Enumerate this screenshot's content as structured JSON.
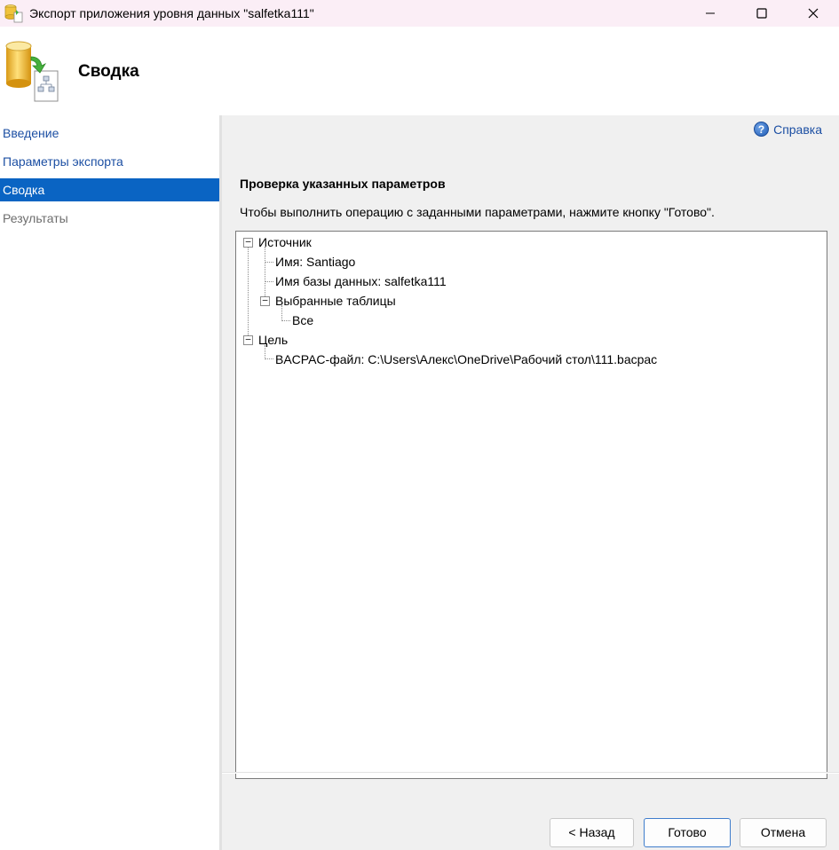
{
  "window": {
    "title": "Экспорт приложения уровня данных \"salfetka111\""
  },
  "header": {
    "title": "Сводка"
  },
  "sidebar": {
    "items": [
      {
        "label": "Введение",
        "state": "link"
      },
      {
        "label": "Параметры экспорта",
        "state": "link"
      },
      {
        "label": "Сводка",
        "state": "active"
      },
      {
        "label": "Результаты",
        "state": "disabled"
      }
    ]
  },
  "main": {
    "help_label": "Справка",
    "heading": "Проверка указанных параметров",
    "description": "Чтобы выполнить операцию с заданными параметрами, нажмите кнопку \"Готово\".",
    "tree": {
      "source": {
        "label": "Источник",
        "name": "Имя: Santiago",
        "database": "Имя базы данных: salfetka111",
        "tables": {
          "label": "Выбранные таблицы",
          "value": "Все"
        }
      },
      "target": {
        "label": "Цель",
        "file": "BACPAC-файл: C:\\Users\\Алекс\\OneDrive\\Рабочий стол\\111.bacpac"
      }
    }
  },
  "buttons": {
    "back": "< Назад",
    "finish": "Готово",
    "cancel": "Отмена"
  },
  "colors": {
    "accent": "#0a64c3",
    "link": "#1c4fa3",
    "title_bar": "#fbeef6",
    "content_bg": "#f0f0f0"
  }
}
